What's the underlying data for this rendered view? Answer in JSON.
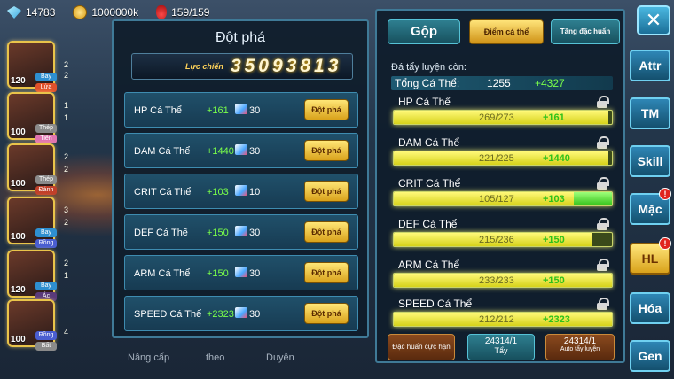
{
  "topbar": {
    "gems": "14783",
    "gold": "1000000k",
    "stamina": "159/159"
  },
  "roster": [
    {
      "level": "120",
      "tags": [
        "Bay",
        "Lửa"
      ],
      "side": [
        "2",
        "2"
      ]
    },
    {
      "level": "100",
      "tags": [
        "Thép",
        "Tiên"
      ],
      "side": [
        "1",
        "1"
      ]
    },
    {
      "level": "100",
      "tags": [
        "Thép",
        "Đánh"
      ],
      "side": [
        "2",
        "2"
      ]
    },
    {
      "level": "100",
      "tags": [
        "Bay",
        "Rồng"
      ],
      "side": [
        "3",
        "2"
      ]
    },
    {
      "level": "120",
      "tags": [
        "Bay",
        "Ác"
      ],
      "side": [
        "2",
        "1"
      ]
    },
    {
      "level": "100",
      "tags": [
        "Rồng",
        "Bất"
      ],
      "side": [
        "4",
        ""
      ]
    }
  ],
  "breakthrough": {
    "title": "Đột phá",
    "power_label": "Lực chiến",
    "power_value": "35093813",
    "button_label": "Đột phá",
    "rows": [
      {
        "label": "HP Cá Thể",
        "bonus": "+161",
        "cost": "30"
      },
      {
        "label": "DAM Cá Thể",
        "bonus": "+1440",
        "cost": "30"
      },
      {
        "label": "CRIT Cá Thể",
        "bonus": "+103",
        "cost": "10"
      },
      {
        "label": "DEF Cá Thể",
        "bonus": "+150",
        "cost": "30"
      },
      {
        "label": "ARM Cá Thể",
        "bonus": "+150",
        "cost": "30"
      },
      {
        "label": "SPEED Cá Thể",
        "bonus": "+2323",
        "cost": "30"
      }
    ]
  },
  "bottom_labels": [
    "Nâng cấp",
    "theo",
    "Duyên"
  ],
  "training": {
    "tabs": {
      "gop": "Gộp",
      "diem": "Điểm cá thể",
      "tang": "Tăng đặc huấn"
    },
    "remain_label": "Đá tẩy luyện còn:",
    "total_label": "Tổng Cá Thể:",
    "total_value": "1255",
    "total_bonus": "+4327",
    "stats": [
      {
        "label": "HP Cá Thể",
        "value": "269/273",
        "bonus": "+161",
        "current": 269,
        "max": 273
      },
      {
        "label": "DAM Cá Thể",
        "value": "221/225",
        "bonus": "+1440",
        "current": 221,
        "max": 225
      },
      {
        "label": "CRIT Cá Thể",
        "value": "105/127",
        "bonus": "+103",
        "current": 105,
        "max": 127
      },
      {
        "label": "DEF Cá Thể",
        "value": "215/236",
        "bonus": "+150",
        "current": 215,
        "max": 236
      },
      {
        "label": "ARM Cá Thể",
        "value": "233/233",
        "bonus": "+150",
        "current": 233,
        "max": 233
      },
      {
        "label": "SPEED Cá Thể",
        "value": "212/212",
        "bonus": "+2323",
        "current": 212,
        "max": 212
      }
    ],
    "buttons": {
      "dac_huan": "Đặc huấn cực hạn",
      "tay_count": "24314/1",
      "tay_label": "Tẩy",
      "auto_count": "24314/1",
      "auto_label": "Auto tẩy luyện"
    }
  },
  "nav": {
    "close": "✕",
    "items": [
      "Attr",
      "TM",
      "Skill",
      "Mặc",
      "HL",
      "Hóa",
      "Gen"
    ],
    "active": "HL",
    "badges": {
      "Mặc": "!",
      "HL": "!"
    }
  },
  "colors": {
    "accent_gold": "#ffd35a",
    "bonus_green": "#7aff4a",
    "panel_border": "#3f7a97"
  }
}
